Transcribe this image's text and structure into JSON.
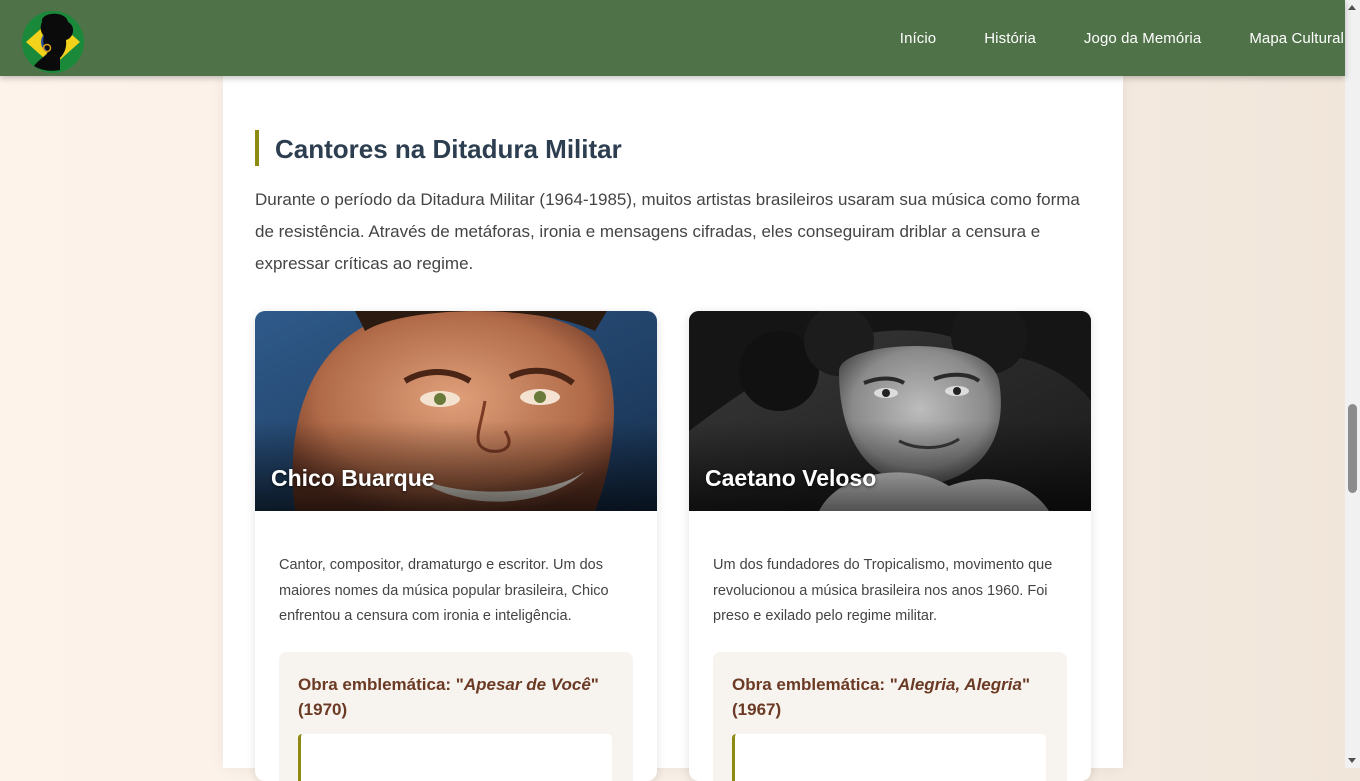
{
  "nav": {
    "links": [
      "Início",
      "História",
      "Jogo da Memória",
      "Mapa Cultural"
    ]
  },
  "section": {
    "title": "Cantores na Ditadura Militar",
    "intro": "Durante o período da Ditadura Militar (1964-1985), muitos artistas brasileiros usaram sua música como forma de resistência. Através de metáforas, ironia e mensagens cifradas, eles conseguiram driblar a censura e expressar críticas ao regime."
  },
  "cards": [
    {
      "name": "Chico Buarque",
      "description": "Cantor, compositor, dramaturgo e escritor. Um dos maiores nomes da música popular brasileira, Chico enfrentou a censura com ironia e inteligência.",
      "work_prefix": "Obra emblemática: \"",
      "work_title": "Apesar de Você",
      "work_suffix": "\" (1970)"
    },
    {
      "name": "Caetano Veloso",
      "description": "Um dos fundadores do Tropicalismo, movimento que revolucionou a música brasileira nos anos 1960. Foi preso e exilado pelo regime militar.",
      "work_prefix": "Obra emblemática: \"",
      "work_title": "Alegria, Alegria",
      "work_suffix": "\" (1967)"
    }
  ],
  "colors": {
    "navbar": "#4f7249",
    "accent": "#8d8a12",
    "heading": "#2c3e50",
    "work_title": "#6b3a24"
  }
}
